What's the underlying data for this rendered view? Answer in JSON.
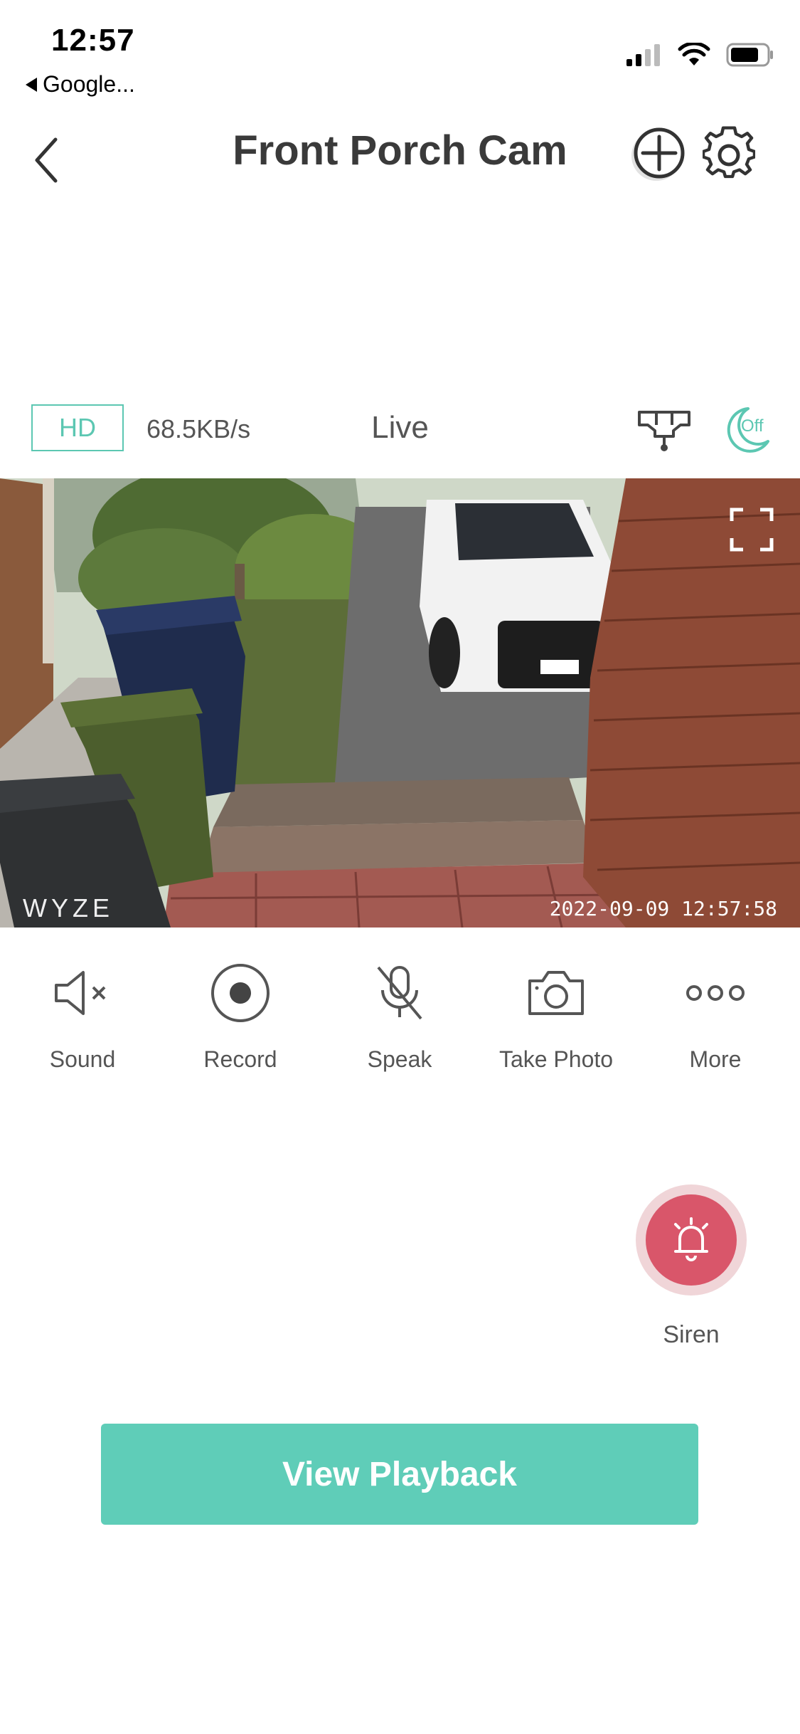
{
  "status_bar": {
    "time": "12:57",
    "back_app": "Google...",
    "icons": [
      "signal-icon",
      "wifi-icon",
      "battery-icon"
    ]
  },
  "header": {
    "title": "Front Porch Cam",
    "icons": [
      "chevron-left-icon",
      "add-circle-icon",
      "gear-icon"
    ]
  },
  "stream_info": {
    "quality": "HD",
    "bitrate": "68.5KB/s",
    "mode": "Live",
    "night_vision": "Off"
  },
  "video": {
    "brand": "WYZE",
    "timestamp": "2022-09-09  12:57:58"
  },
  "controls": [
    {
      "label": "Sound",
      "icon": "speaker-muted-icon"
    },
    {
      "label": "Record",
      "icon": "record-icon"
    },
    {
      "label": "Speak",
      "icon": "mic-off-icon"
    },
    {
      "label": "Take Photo",
      "icon": "camera-icon"
    },
    {
      "label": "More",
      "icon": "more-dots-icon"
    }
  ],
  "siren": {
    "label": "Siren"
  },
  "playback": {
    "label": "View Playback"
  },
  "colors": {
    "accent": "#5fcdb8",
    "siren": "#d9566a"
  }
}
